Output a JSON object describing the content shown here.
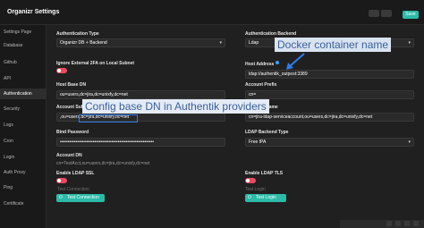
{
  "header": {
    "title": "Organizr Settings",
    "save_label": "Save"
  },
  "sidebar": {
    "items": [
      {
        "label": "Settings Page",
        "active": false
      },
      {
        "label": "Database",
        "active": false
      },
      {
        "label": "Github",
        "active": false
      },
      {
        "label": "API",
        "active": false
      },
      {
        "label": "Authentication",
        "active": true
      },
      {
        "label": "Security",
        "active": false
      },
      {
        "label": "Logs",
        "active": false
      },
      {
        "label": "Cron",
        "active": false
      },
      {
        "label": "Login",
        "active": false
      },
      {
        "label": "Auth Proxy",
        "active": false
      },
      {
        "label": "Ping",
        "active": false
      },
      {
        "label": "Certificate",
        "active": false
      }
    ]
  },
  "form": {
    "auth_type_label": "Authentication Type",
    "auth_type_value": "Organizr DB + Backend",
    "auth_backend_label": "Authentication Backend",
    "auth_backend_value": "Ldap",
    "ignore_2fa_label": "Ignore External 2FA on Local Subnet",
    "host_address_label": "Host Address",
    "host_address_value": "ldap://authentik_outpost:3389",
    "host_base_dn_label": "Host Base DN",
    "host_base_dn_value": "ou=users,dc=jira,dc=unixfy,dc=net",
    "account_prefix_label": "Account Prefix",
    "account_prefix_value": "cn=",
    "account_suffix_label": "Account Suffix",
    "account_suffix_value": ",ou=users,dc=jira,dc=unixfy,dc=net",
    "bind_username_label": "Bind Username",
    "bind_username_value": "cn=jira-ldap-serviceaccount,ou=users,dc=jira,dc=unixfy,dc=net",
    "bind_password_label": "Bind Password",
    "bind_password_value": "••••••••••••••••••••••••••••••••••••••••••••••••••••••••••••",
    "ldap_backend_type_label": "LDAP Backend Type",
    "ldap_backend_type_value": "Free IPA",
    "account_dn_label": "Account DN",
    "account_dn_help": "cn=TestAcct,ou=users,dc=jira,dc=unixfy,dc=net",
    "enable_ssl_label": "Enable LDAP SSL",
    "enable_tls_label": "Enable LDAP TLS",
    "test_connection_label": "Test Connection",
    "test_connection_button": "Test Connection",
    "test_login_label": "Test Login",
    "test_login_button": "Test Login"
  },
  "annotations": {
    "docker_label": "Docker container name",
    "basedn_label": "Config base DN in Authentik providers"
  },
  "colors": {
    "accent": "#2bbba8",
    "toggle_off": "#e84b5f",
    "annotation_blue": "#2d7cf2"
  }
}
